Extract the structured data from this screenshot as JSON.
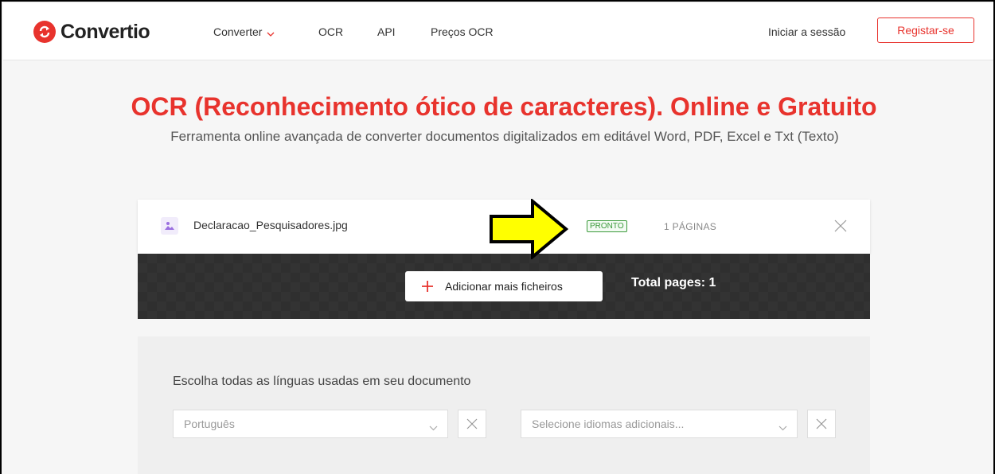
{
  "header": {
    "logo_text": "Convertio",
    "nav": [
      {
        "label": "Converter"
      },
      {
        "label": "OCR"
      },
      {
        "label": "API"
      },
      {
        "label": "Preços OCR"
      }
    ],
    "login_label": "Iniciar a sessão",
    "register_label": "Registar-se"
  },
  "hero": {
    "title": "OCR (Reconhecimento ótico de caracteres). Online e Gratuito",
    "subtitle": "Ferramenta online avançada de converter documentos digitalizados em editável Word, PDF, Excel e Txt (Texto)"
  },
  "file": {
    "name": "Declaracao_Pesquisadores.jpg",
    "status": "PRONTO",
    "pages": "1 PÁGINAS"
  },
  "upload": {
    "add_label": "Adicionar mais ficheiros",
    "total_pages": "Total pages: 1"
  },
  "languages": {
    "label": "Escolha todas as línguas usadas em seu documento",
    "primary_value": "Português",
    "additional_placeholder": "Selecione idiomas adicionais..."
  },
  "colors": {
    "brand": "#e8332d",
    "status_green": "#3a9a3a",
    "annotation_arrow": "#ffff00"
  }
}
